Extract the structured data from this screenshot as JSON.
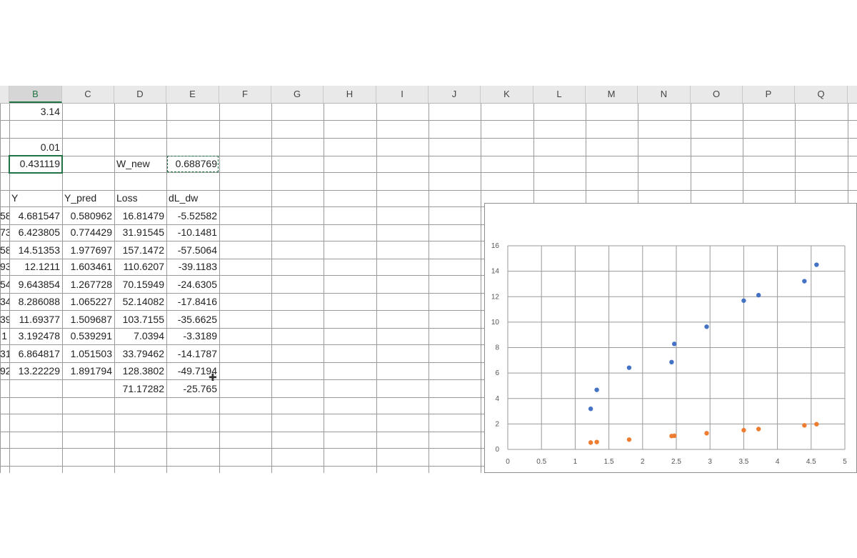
{
  "columns": [
    "B",
    "C",
    "D",
    "E",
    "F",
    "G",
    "H",
    "I",
    "J",
    "K",
    "L",
    "M",
    "N",
    "O",
    "P",
    "Q"
  ],
  "selected_column": "B",
  "cells": {
    "b_row1": "3.14",
    "b_row3": "0.01",
    "b_row4": "0.431119",
    "d_row4": "W_new",
    "e_row4": "0.688769"
  },
  "table": {
    "headers": [
      "Y",
      "Y_pred",
      "Loss",
      "dL_dw"
    ],
    "left_clipped": [
      "58",
      "73",
      "58",
      "93",
      "54",
      "34",
      "39",
      "1",
      "31",
      "92"
    ],
    "rows": [
      [
        "4.681547",
        "0.580962",
        "16.81479",
        "-5.52582"
      ],
      [
        "6.423805",
        "0.774429",
        "31.91545",
        "-10.1481"
      ],
      [
        "14.51353",
        "1.977697",
        "157.1472",
        "-57.5064"
      ],
      [
        "12.1211",
        "1.603461",
        "110.6207",
        "-39.1183"
      ],
      [
        "9.643854",
        "1.267728",
        "70.15949",
        "-24.6305"
      ],
      [
        "8.286088",
        "1.065227",
        "52.14082",
        "-17.8416"
      ],
      [
        "11.69377",
        "1.509687",
        "103.7155",
        "-35.6625"
      ],
      [
        "3.192478",
        "0.539291",
        "7.0394",
        "-3.3189"
      ],
      [
        "6.864817",
        "1.051503",
        "33.79462",
        "-14.1787"
      ],
      [
        "13.22229",
        "1.891794",
        "128.3802",
        "-49.7194"
      ]
    ],
    "totals": [
      "71.17282",
      "-25.765"
    ]
  },
  "chart_data": {
    "type": "scatter",
    "title": "",
    "xlabel": "",
    "ylabel": "",
    "xlim": [
      0,
      5
    ],
    "ylim": [
      0,
      16
    ],
    "x_ticks": [
      "0",
      "0.5",
      "1",
      "1.5",
      "2",
      "2.5",
      "3",
      "3.5",
      "4",
      "4.5",
      "5"
    ],
    "y_ticks": [
      "0",
      "2",
      "4",
      "6",
      "8",
      "10",
      "12",
      "14",
      "16"
    ],
    "grid": true,
    "legend": "none",
    "series": [
      {
        "color": "#4472c4",
        "points": [
          [
            1.23,
            3.19
          ],
          [
            1.32,
            4.68
          ],
          [
            1.8,
            6.42
          ],
          [
            2.43,
            6.86
          ],
          [
            2.47,
            8.29
          ],
          [
            2.95,
            9.64
          ],
          [
            3.5,
            11.69
          ],
          [
            3.72,
            12.12
          ],
          [
            4.4,
            13.22
          ],
          [
            4.58,
            14.51
          ]
        ]
      },
      {
        "color": "#ed7d31",
        "points": [
          [
            1.23,
            0.54
          ],
          [
            1.32,
            0.58
          ],
          [
            1.8,
            0.77
          ],
          [
            2.43,
            1.05
          ],
          [
            2.47,
            1.07
          ],
          [
            2.95,
            1.27
          ],
          [
            3.5,
            1.51
          ],
          [
            3.72,
            1.6
          ],
          [
            4.4,
            1.89
          ],
          [
            4.58,
            1.98
          ]
        ]
      }
    ]
  }
}
